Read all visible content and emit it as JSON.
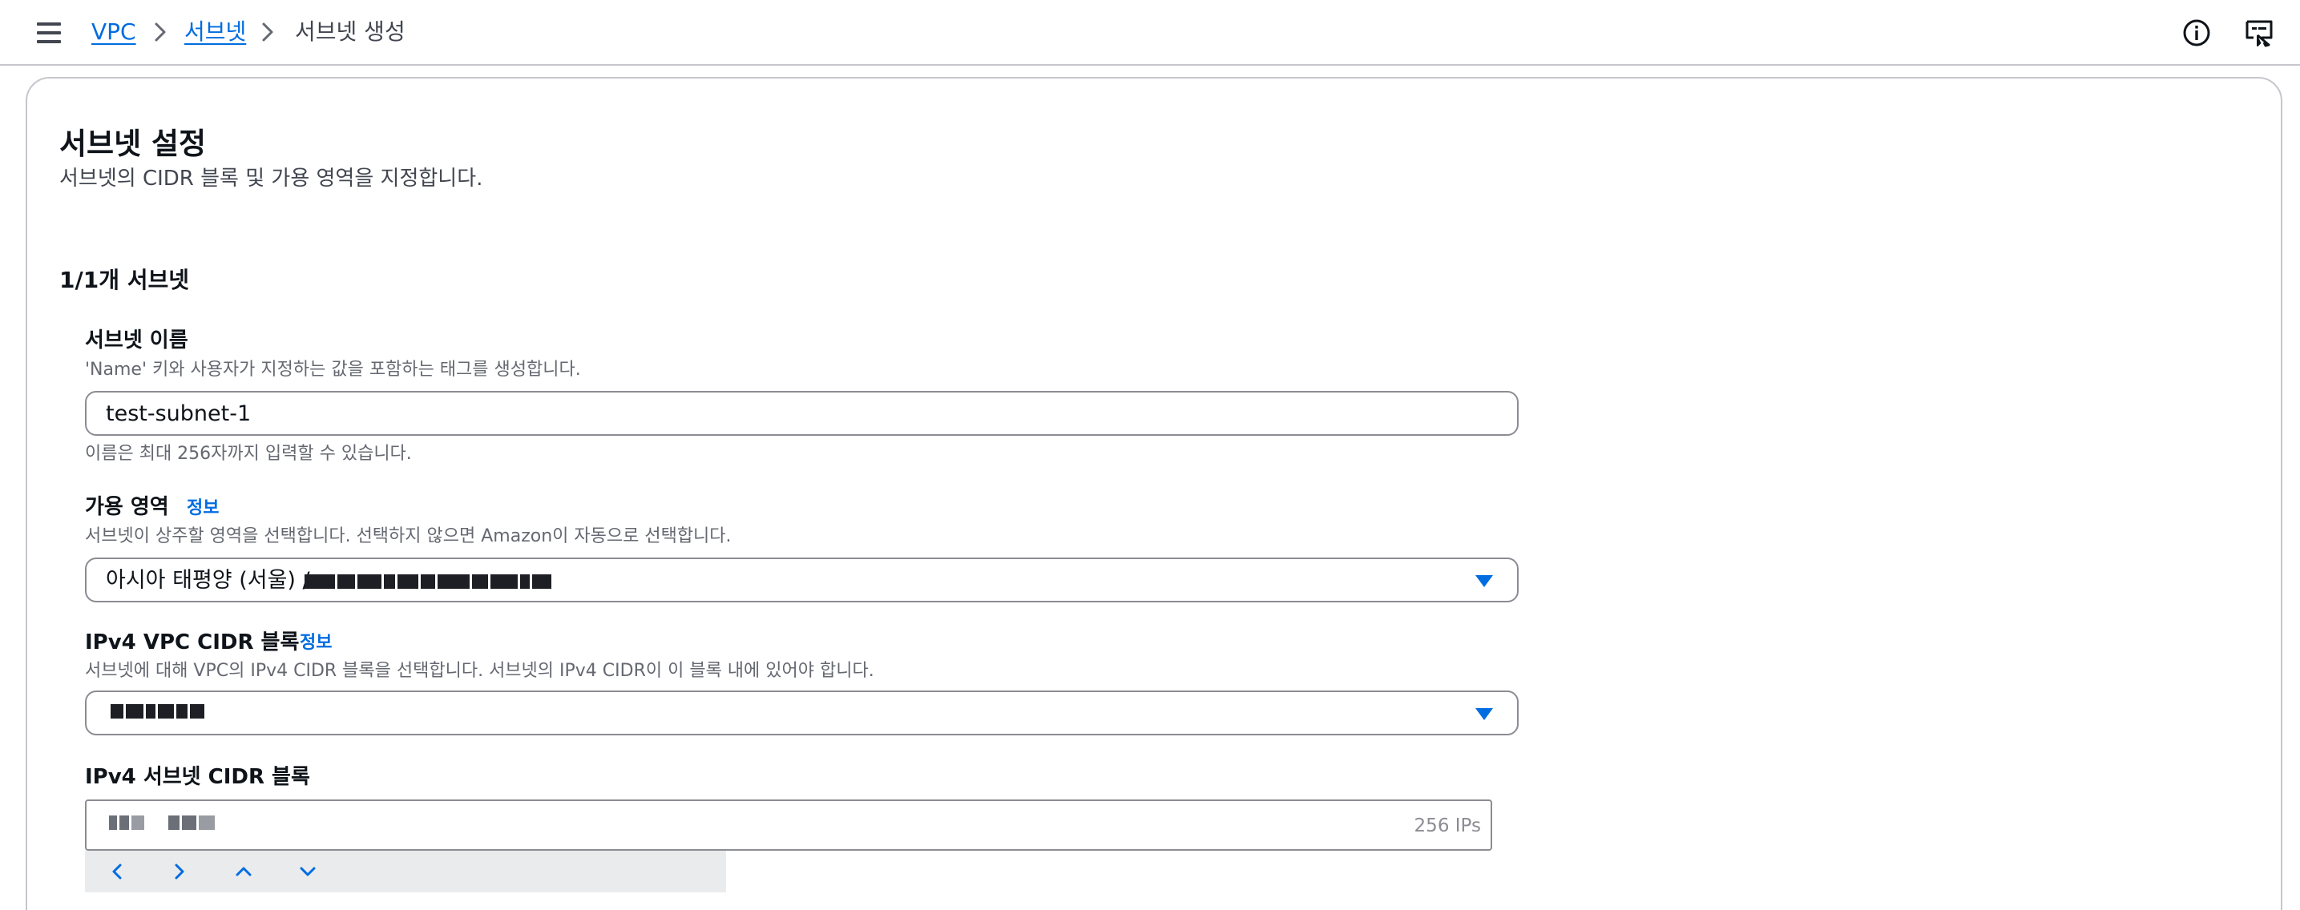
{
  "breadcrumb": {
    "items": [
      "VPC",
      "서브넷"
    ],
    "current": "서브넷 생성"
  },
  "icons": {
    "menu": "hamburger-menu-icon",
    "info": "info-circle-icon",
    "feedback": "screen-feedback-icon",
    "chevron": "chevron-right-icon"
  },
  "colors": {
    "accent": "#006ce0",
    "text": "#0f141a",
    "muted": "#656871",
    "border": "#8c8c94"
  },
  "section": {
    "title": "서브넷 설정",
    "description": "서브넷의 CIDR 블록 및 가용 영역을 지정합니다.",
    "count_title": "1/1개 서브넷"
  },
  "subnet_name": {
    "label": "서브넷 이름",
    "hint": "'Name' 키와 사용자가 지정하는 값을 포함하는 태그를 생성합니다.",
    "value": "test-subnet-1",
    "constraint": "이름은 최대 256자까지 입력할 수 있습니다."
  },
  "availability_zone": {
    "label": "가용 영역",
    "info": "정보",
    "hint": "서브넷이 상주할 영역을 선택합니다. 선택하지 않으면 Amazon이 자동으로 선택합니다.",
    "value_prefix": "아시아 태평양 (서울) /"
  },
  "vpc_cidr": {
    "label": "IPv4 VPC CIDR 블록",
    "info": "정보",
    "hint": "서브넷에 대해 VPC의 IPv4 CIDR 블록을 선택합니다. 서브넷의 IPv4 CIDR이 이 블록 내에 있어야 합니다."
  },
  "subnet_cidr": {
    "label": "IPv4 서브넷 CIDR 블록",
    "ip_count": "256 IPs",
    "steppers": [
      "chevron-left-icon",
      "chevron-right-icon",
      "chevron-up-icon",
      "chevron-down-icon"
    ]
  }
}
